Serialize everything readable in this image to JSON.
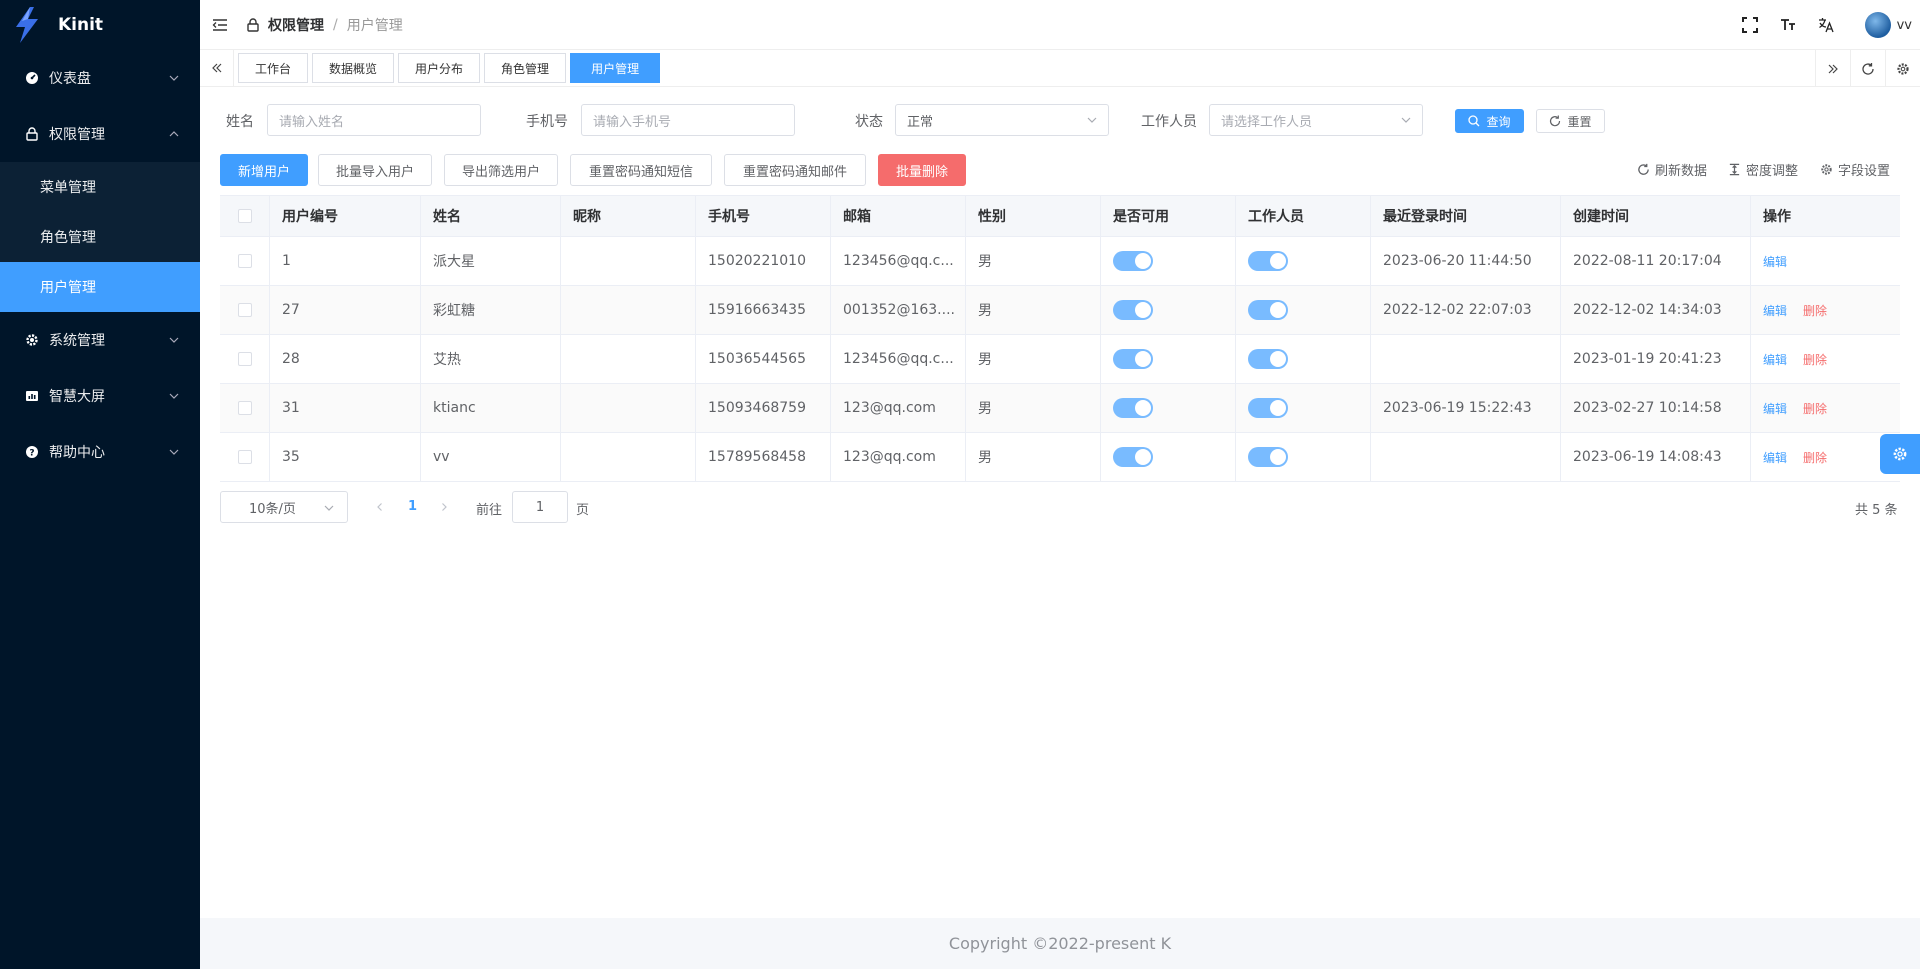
{
  "app": {
    "name": "Kinit"
  },
  "sidebar": {
    "items": [
      {
        "label": "仪表盘",
        "icon": "dashboard-icon"
      },
      {
        "label": "权限管理",
        "icon": "lock-icon",
        "children": [
          "菜单管理",
          "角色管理",
          "用户管理"
        ],
        "active_child": "用户管理"
      },
      {
        "label": "系统管理",
        "icon": "gear-icon"
      },
      {
        "label": "智慧大屏",
        "icon": "bar-chart-icon"
      },
      {
        "label": "帮助中心",
        "icon": "help-icon"
      }
    ]
  },
  "header": {
    "breadcrumb": [
      "权限管理",
      "用户管理"
    ],
    "breadcrumb_sep": "/",
    "user_name": "vv"
  },
  "tags": [
    "工作台",
    "数据概览",
    "用户分布",
    "角色管理",
    "用户管理"
  ],
  "search": {
    "name_label": "姓名",
    "name_placeholder": "请输入姓名",
    "phone_label": "手机号",
    "phone_placeholder": "请输入手机号",
    "status_label": "状态",
    "status_value": "正常",
    "staff_label": "工作人员",
    "staff_placeholder": "请选择工作人员",
    "query_label": "查询",
    "reset_label": "重置"
  },
  "toolbar": {
    "add": "新增用户",
    "import": "批量导入用户",
    "export": "导出筛选用户",
    "reset_sms": "重置密码通知短信",
    "reset_email": "重置密码通知邮件",
    "batch_delete": "批量删除",
    "refresh": "刷新数据",
    "density": "密度调整",
    "fields": "字段设置"
  },
  "table": {
    "columns": [
      "用户编号",
      "姓名",
      "昵称",
      "手机号",
      "邮箱",
      "性别",
      "是否可用",
      "工作人员",
      "最近登录时间",
      "创建时间",
      "操作"
    ],
    "rows": [
      {
        "id": "1",
        "name": "派大星",
        "nickname": "",
        "phone": "15020221010",
        "email": "123456@qq.c...",
        "gender": "男",
        "last_login": "2023-06-20 11:44:50",
        "created": "2022-08-11 20:17:04",
        "can_delete": false
      },
      {
        "id": "27",
        "name": "彩虹糖",
        "nickname": "",
        "phone": "15916663435",
        "email": "001352@163....",
        "gender": "男",
        "last_login": "2022-12-02 22:07:03",
        "created": "2022-12-02 14:34:03",
        "can_delete": true
      },
      {
        "id": "28",
        "name": "艾热",
        "nickname": "",
        "phone": "15036544565",
        "email": "123456@qq.c...",
        "gender": "男",
        "last_login": "",
        "created": "2023-01-19 20:41:23",
        "can_delete": true
      },
      {
        "id": "31",
        "name": "ktianc",
        "nickname": "",
        "phone": "15093468759",
        "email": "123@qq.com",
        "gender": "男",
        "last_login": "2023-06-19 15:22:43",
        "created": "2023-02-27 10:14:58",
        "can_delete": true
      },
      {
        "id": "35",
        "name": "vv",
        "nickname": "",
        "phone": "15789568458",
        "email": "123@qq.com",
        "gender": "男",
        "last_login": "",
        "created": "2023-06-19 14:08:43",
        "can_delete": true
      }
    ],
    "edit_label": "编辑",
    "delete_label": "删除"
  },
  "pagination": {
    "page_size": "10条/页",
    "current_page": "1",
    "goto_prefix": "前往",
    "goto_value": "1",
    "goto_suffix": "页",
    "total": "共 5 条"
  },
  "footer": {
    "copyright": "Copyright ©2022-present K"
  },
  "colors": {
    "primary": "#409eff",
    "danger": "#f56c6c",
    "sidebar_bg": "#001529"
  }
}
